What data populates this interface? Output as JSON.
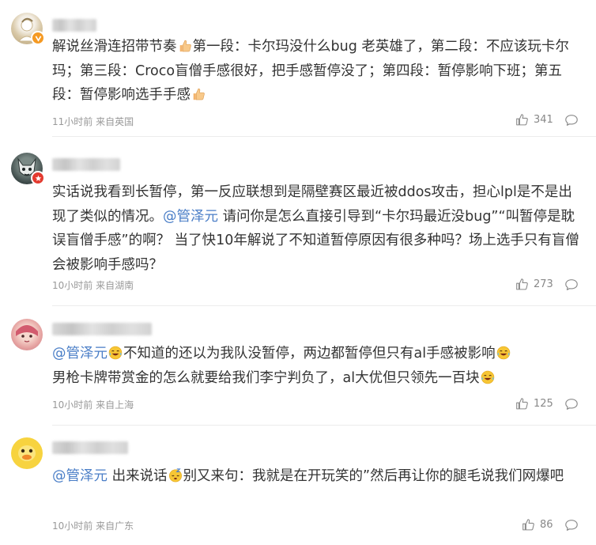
{
  "comments": [
    {
      "text_a": "解说丝滑连招带节奏",
      "text_b": "第一段：卡尔玛没什么bug 老英雄了，第二段：不应该玩卡尔玛；第三段：Croco盲僧手感很好，把手感暂停没了；第四段：暂停影响下班；第五段：暂停影响选手手感",
      "time": "11小时前 来自英国",
      "likes": "341",
      "badge": "orange"
    },
    {
      "text_a": "实话说我看到长暂停，第一反应联想到是隔壁赛区最近被ddos攻击，担心lpl是不是出现了类似的情况。",
      "mention": "@管泽元",
      "text_b": " 请问你是怎么直接引导到“卡尔玛最近没bug”“叫暂停是耽误盲僧手感”的啊？ 当了快10年解说了不知道暂停原因有很多种吗？场上选手只有盲僧会被影响手感吗？",
      "time": "10小时前 来自湖南",
      "likes": "273",
      "badge": "red"
    },
    {
      "mention": "@管泽元",
      "text_a": "不知道的还以为我队没暂停，两边都暂停但只有al手感被影响",
      "text_b": "男枪卡牌带赏金的怎么就要给我们李宁判负了，al大优但只领先一百块",
      "time": "10小时前 来自上海",
      "likes": "125",
      "badge": "orange"
    },
    {
      "mention": "@管泽元",
      "text_a": " 出来说话",
      "text_b": "别又来句：我就是在开玩笑的”然后再让你的腿毛说我们网爆吧",
      "time": "10小时前 来自广东",
      "likes": "86",
      "badge": "none"
    }
  ]
}
